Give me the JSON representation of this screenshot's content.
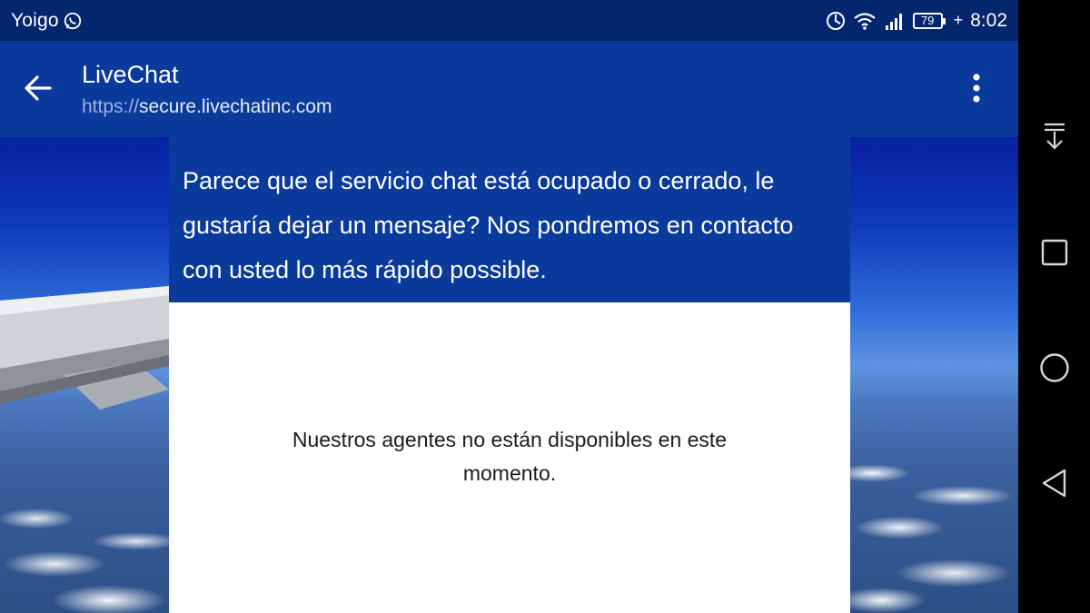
{
  "status_bar": {
    "carrier": "Yoigo",
    "battery": "79",
    "charging_symbol": "+",
    "time": "8:02",
    "icons": [
      "whatsapp-icon",
      "data-saver-icon",
      "wifi-icon",
      "signal-icon",
      "battery-icon"
    ]
  },
  "app_bar": {
    "title": "LiveChat",
    "url_scheme": "https://",
    "url_host": "secure.livechatinc.com",
    "back_icon": "arrow-back-icon",
    "menu_icon": "more-vertical-icon",
    "color": "#0a3a9c"
  },
  "chat_panel": {
    "header_message": " Parece que el servicio chat está ocupado o cerrado, le gustaría dejar un mensaje? Nos pondremos en contacto con usted lo más rápido possible.",
    "body_message": "Nuestros agentes no están disponibles en este momento.",
    "header_color": "#0a3a9c"
  },
  "nav_bar": {
    "buttons": [
      "notification-pull-icon",
      "recents-icon",
      "home-icon",
      "back-icon"
    ]
  }
}
